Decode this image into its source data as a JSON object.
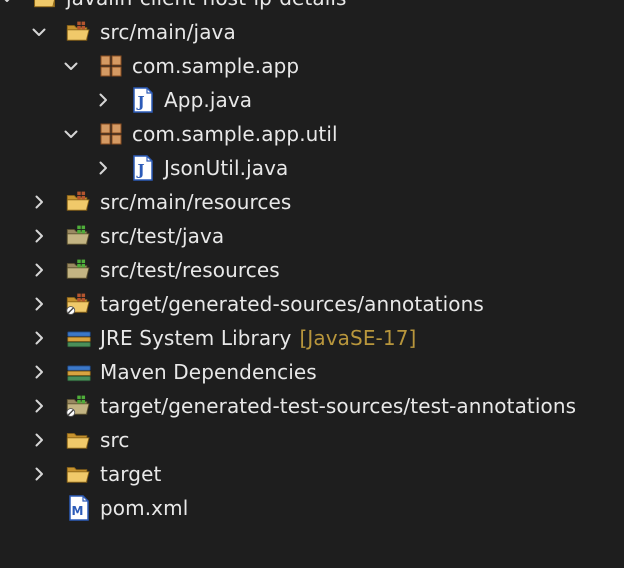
{
  "project_explorer": {
    "items": [
      {
        "id": "project",
        "label": "javalin-client-host-ip-details",
        "level": 0,
        "expanded": true,
        "icon": "maven-project-icon",
        "decoration": ""
      },
      {
        "id": "src-main-java",
        "label": "src/main/java",
        "level": 1,
        "expanded": true,
        "icon": "source-folder-icon",
        "decoration": ""
      },
      {
        "id": "pkg-app",
        "label": "com.sample.app",
        "level": 2,
        "expanded": true,
        "icon": "package-icon",
        "decoration": ""
      },
      {
        "id": "app-java",
        "label": "App.java",
        "level": 3,
        "expanded": false,
        "icon": "java-file-icon",
        "decoration": ""
      },
      {
        "id": "pkg-util",
        "label": "com.sample.app.util",
        "level": 2,
        "expanded": true,
        "icon": "package-icon",
        "decoration": ""
      },
      {
        "id": "jsonutil-java",
        "label": "JsonUtil.java",
        "level": 3,
        "expanded": false,
        "icon": "java-file-icon",
        "decoration": ""
      },
      {
        "id": "src-main-resources",
        "label": "src/main/resources",
        "level": 1,
        "expanded": false,
        "icon": "source-folder-icon",
        "decoration": ""
      },
      {
        "id": "src-test-java",
        "label": "src/test/java",
        "level": 1,
        "expanded": false,
        "icon": "test-source-folder-icon",
        "decoration": ""
      },
      {
        "id": "src-test-resources",
        "label": "src/test/resources",
        "level": 1,
        "expanded": false,
        "icon": "test-source-folder-icon",
        "decoration": ""
      },
      {
        "id": "gen-sources",
        "label": "target/generated-sources/annotations",
        "level": 1,
        "expanded": false,
        "icon": "generated-source-folder-icon",
        "decoration": ""
      },
      {
        "id": "jre",
        "label": "JRE System Library",
        "level": 1,
        "expanded": false,
        "icon": "library-icon",
        "decoration": "[JavaSE-17]"
      },
      {
        "id": "maven-deps",
        "label": "Maven Dependencies",
        "level": 1,
        "expanded": false,
        "icon": "library-icon",
        "decoration": ""
      },
      {
        "id": "gen-test-sources",
        "label": "target/generated-test-sources/test-annotations",
        "level": 1,
        "expanded": false,
        "icon": "generated-test-source-folder-icon",
        "decoration": ""
      },
      {
        "id": "src",
        "label": "src",
        "level": 1,
        "expanded": false,
        "icon": "folder-icon",
        "decoration": ""
      },
      {
        "id": "target",
        "label": "target",
        "level": 1,
        "expanded": false,
        "icon": "folder-icon",
        "decoration": ""
      },
      {
        "id": "pom",
        "label": "pom.xml",
        "level": 1,
        "expanded": null,
        "icon": "maven-pom-icon",
        "decoration": ""
      }
    ]
  },
  "colors": {
    "background": "#1e1e1e",
    "text": "#e8e8e8",
    "decoration_text": "#b8963c",
    "chevron": "#d6d6d6",
    "folder": "#e5b659",
    "package": "#c98a52",
    "java_blue": "#2c5bb8",
    "test_green": "#4fae3a"
  }
}
